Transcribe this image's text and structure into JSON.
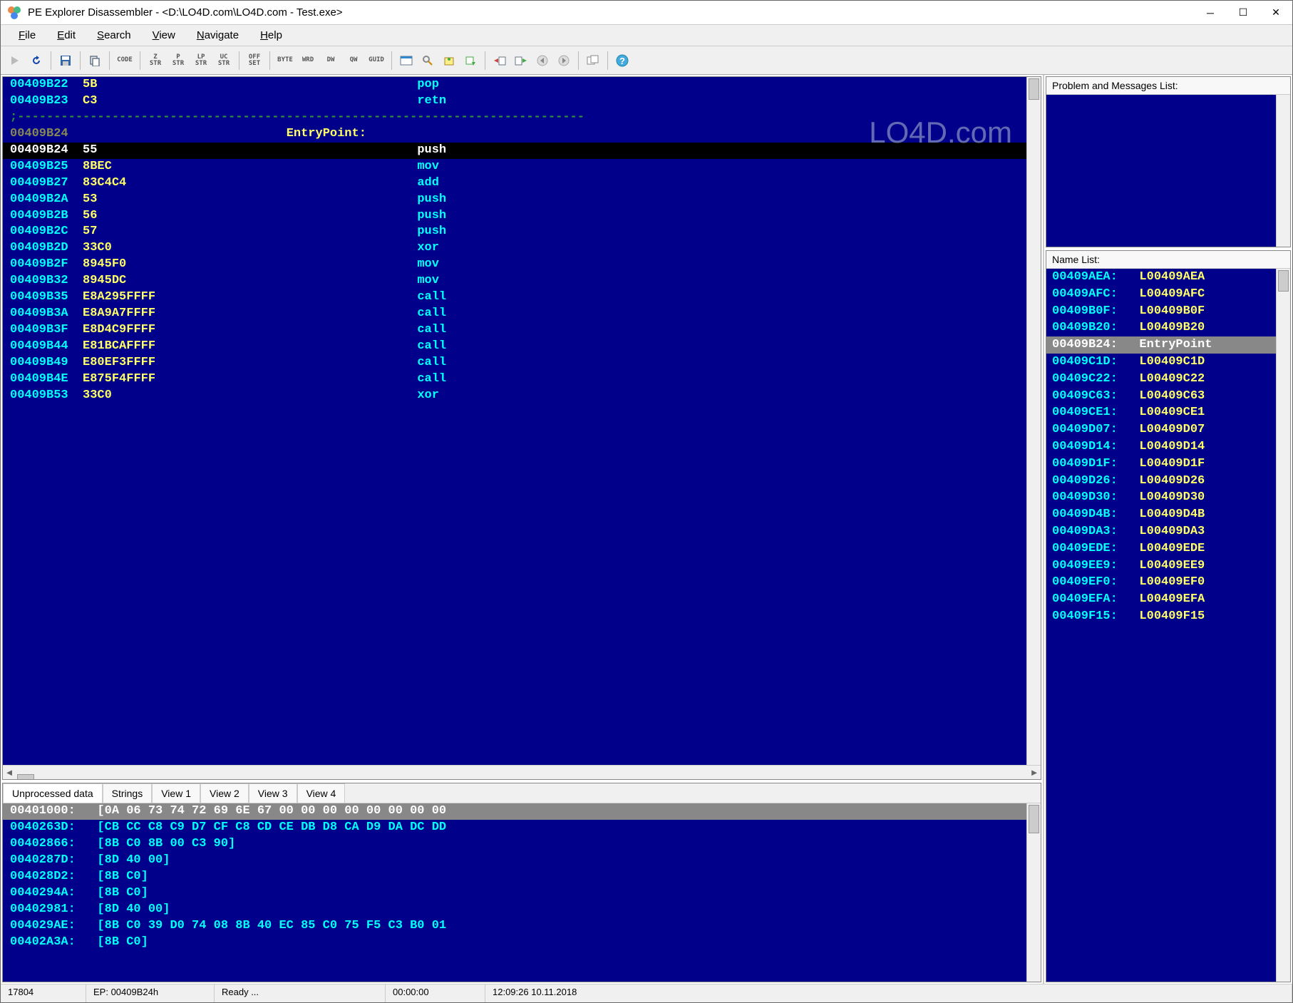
{
  "window": {
    "title": "PE Explorer Disassembler - <D:\\LO4D.com\\LO4D.com - Test.exe>"
  },
  "menu": {
    "items": [
      {
        "label": "File",
        "accel": "F"
      },
      {
        "label": "Edit",
        "accel": "E"
      },
      {
        "label": "Search",
        "accel": "S"
      },
      {
        "label": "View",
        "accel": "V"
      },
      {
        "label": "Navigate",
        "accel": "N"
      },
      {
        "label": "Help",
        "accel": "H"
      }
    ]
  },
  "toolbar": {
    "txt": [
      "CODE",
      "Z\nSTR",
      "P\nSTR",
      "LP\nSTR",
      "UC\nSTR",
      "OFF\nSET",
      "BYTE",
      "WRD",
      "DW",
      "QW",
      "GUID"
    ]
  },
  "disasm": {
    "entry_label": "EntryPoint:",
    "rows": [
      {
        "addr": "00409B22",
        "hex": "5B",
        "mnem": "pop"
      },
      {
        "addr": "00409B23",
        "hex": "C3",
        "mnem": "retn"
      },
      {
        "sep": ";------------------------------------------------------------------------------"
      },
      {
        "addr": "00409B24",
        "hex": "",
        "mnem": "",
        "dim": true,
        "label": "EntryPoint:"
      },
      {
        "addr": "00409B24",
        "hex": "55",
        "mnem": "push",
        "sel": true
      },
      {
        "addr": "00409B25",
        "hex": "8BEC",
        "mnem": "mov"
      },
      {
        "addr": "00409B27",
        "hex": "83C4C4",
        "mnem": "add"
      },
      {
        "addr": "00409B2A",
        "hex": "53",
        "mnem": "push"
      },
      {
        "addr": "00409B2B",
        "hex": "56",
        "mnem": "push"
      },
      {
        "addr": "00409B2C",
        "hex": "57",
        "mnem": "push"
      },
      {
        "addr": "00409B2D",
        "hex": "33C0",
        "mnem": "xor"
      },
      {
        "addr": "00409B2F",
        "hex": "8945F0",
        "mnem": "mov"
      },
      {
        "addr": "00409B32",
        "hex": "8945DC",
        "mnem": "mov"
      },
      {
        "addr": "00409B35",
        "hex": "E8A295FFFF",
        "mnem": "call"
      },
      {
        "addr": "00409B3A",
        "hex": "E8A9A7FFFF",
        "mnem": "call"
      },
      {
        "addr": "00409B3F",
        "hex": "E8D4C9FFFF",
        "mnem": "call"
      },
      {
        "addr": "00409B44",
        "hex": "E81BCAFFFF",
        "mnem": "call"
      },
      {
        "addr": "00409B49",
        "hex": "E80EF3FFFF",
        "mnem": "call"
      },
      {
        "addr": "00409B4E",
        "hex": "E875F4FFFF",
        "mnem": "call"
      },
      {
        "addr": "00409B53",
        "hex": "33C0",
        "mnem": "xor"
      }
    ]
  },
  "tabs": {
    "items": [
      "Unprocessed data",
      "Strings",
      "View 1",
      "View 2",
      "View 3",
      "View 4"
    ],
    "active": 0
  },
  "hex": {
    "rows": [
      {
        "addr": "00401000:",
        "bytes": "[0A 06 73 74 72 69 6E 67 00 00 00 00 00 00 00 00",
        "first": true
      },
      {
        "addr": "0040263D:",
        "bytes": "[CB CC C8 C9 D7 CF C8 CD CE DB D8 CA D9 DA DC DD"
      },
      {
        "addr": "00402866:",
        "bytes": "[8B C0 8B 00 C3 90]"
      },
      {
        "addr": "0040287D:",
        "bytes": "[8D 40 00]"
      },
      {
        "addr": "004028D2:",
        "bytes": "[8B C0]"
      },
      {
        "addr": "0040294A:",
        "bytes": "[8B C0]"
      },
      {
        "addr": "00402981:",
        "bytes": "[8D 40 00]"
      },
      {
        "addr": "004029AE:",
        "bytes": "[8B C0 39 D0 74 08 8B 40 EC 85 C0 75 F5 C3 B0 01"
      },
      {
        "addr": "00402A3A:",
        "bytes": "[8B C0]"
      }
    ]
  },
  "panels": {
    "messages_title": "Problem and Messages List:",
    "names_title": "Name List:"
  },
  "names": [
    {
      "addr": "00409AEA:",
      "name": "L00409AEA"
    },
    {
      "addr": "00409AFC:",
      "name": "L00409AFC"
    },
    {
      "addr": "00409B0F:",
      "name": "L00409B0F"
    },
    {
      "addr": "00409B20:",
      "name": "L00409B20"
    },
    {
      "addr": "00409B24:",
      "name": "EntryPoint",
      "sel": true
    },
    {
      "addr": "00409C1D:",
      "name": "L00409C1D"
    },
    {
      "addr": "00409C22:",
      "name": "L00409C22"
    },
    {
      "addr": "00409C63:",
      "name": "L00409C63"
    },
    {
      "addr": "00409CE1:",
      "name": "L00409CE1"
    },
    {
      "addr": "00409D07:",
      "name": "L00409D07"
    },
    {
      "addr": "00409D14:",
      "name": "L00409D14"
    },
    {
      "addr": "00409D1F:",
      "name": "L00409D1F"
    },
    {
      "addr": "00409D26:",
      "name": "L00409D26"
    },
    {
      "addr": "00409D30:",
      "name": "L00409D30"
    },
    {
      "addr": "00409D4B:",
      "name": "L00409D4B"
    },
    {
      "addr": "00409DA3:",
      "name": "L00409DA3"
    },
    {
      "addr": "00409EDE:",
      "name": "L00409EDE"
    },
    {
      "addr": "00409EE9:",
      "name": "L00409EE9"
    },
    {
      "addr": "00409EF0:",
      "name": "L00409EF0"
    },
    {
      "addr": "00409EFA:",
      "name": "L00409EFA"
    },
    {
      "addr": "00409F15:",
      "name": "L00409F15"
    }
  ],
  "status": {
    "count": "17804",
    "ep": "EP: 00409B24h",
    "ready": "Ready ...",
    "elapsed": "00:00:00",
    "time": "12:09:26 10.11.2018"
  },
  "watermark": "LO4D.com"
}
